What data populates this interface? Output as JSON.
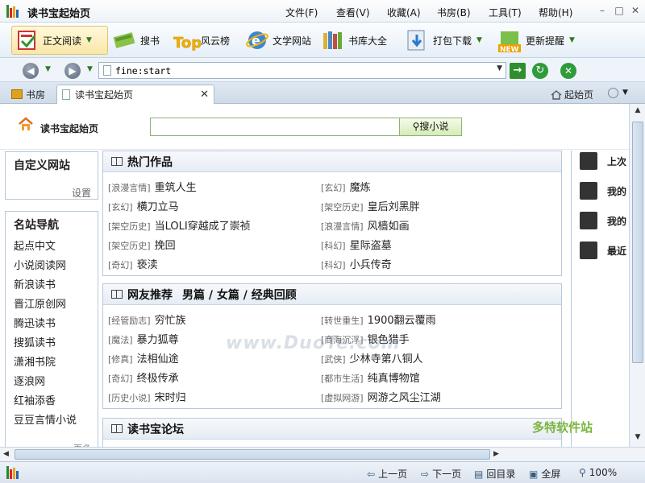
{
  "window": {
    "title": "读书宝起始页"
  },
  "menu": [
    "文件(F)",
    "查看(V)",
    "收藏(A)",
    "书房(B)",
    "工具(T)",
    "帮助(H)"
  ],
  "toolbar": [
    {
      "label": "正文阅读",
      "icon": "read-book-icon"
    },
    {
      "label": "搜书",
      "icon": "search-book-icon"
    },
    {
      "label": "风云榜",
      "icon": "top-ranking-icon"
    },
    {
      "label": "文学网站",
      "icon": "ie-globe-icon"
    },
    {
      "label": "书库大全",
      "icon": "library-icon"
    },
    {
      "label": "打包下载",
      "icon": "download-icon"
    },
    {
      "label": "更新提醒",
      "icon": "new-alert-icon"
    }
  ],
  "address": {
    "value": "fine:start"
  },
  "tabs": [
    {
      "label": "书房"
    },
    {
      "label": "读书宝起始页"
    }
  ],
  "tab_right": {
    "home_label": "起始页"
  },
  "page": {
    "title": "读书宝起始页",
    "search_button": "搜小说",
    "left": {
      "custom_title": "自定义网站",
      "settings": "设置",
      "nav_title": "名站导航",
      "nav_items": [
        "起点中文",
        "小说阅读网",
        "新浪读书",
        "晋江原创网",
        "腾迅读书",
        "搜狐读书",
        "潇湘书院",
        "逐浪网",
        "红袖添香",
        "豆豆言情小说"
      ],
      "more": "更多"
    },
    "hot": {
      "title": "热门作品",
      "items": [
        {
          "tag": "[浪漫言情]",
          "name": "重筑人生"
        },
        {
          "tag": "[玄幻]",
          "name": "魔炼"
        },
        {
          "tag": "[玄幻]",
          "name": "横刀立马"
        },
        {
          "tag": "[架空历史]",
          "name": "皇后刘黑胖"
        },
        {
          "tag": "[架空历史]",
          "name": "当LOLI穿越成了崇祯"
        },
        {
          "tag": "[浪漫言情]",
          "name": "风樯如画"
        },
        {
          "tag": "[架空历史]",
          "name": "挽回"
        },
        {
          "tag": "[科幻]",
          "name": "星际盗墓"
        },
        {
          "tag": "[奇幻]",
          "name": "亵渎"
        },
        {
          "tag": "[科幻]",
          "name": "小兵传奇"
        }
      ]
    },
    "rec": {
      "title": "网友推荐",
      "filters": "男篇 / 女篇 / 经典回顾",
      "items": [
        {
          "tag": "[经管励志]",
          "name": "穷忙族"
        },
        {
          "tag": "[转世重生]",
          "name": "1900翻云覆雨"
        },
        {
          "tag": "[魔法]",
          "name": "暴力狐尊"
        },
        {
          "tag": "[商海沉浮]",
          "name": "银色猎手"
        },
        {
          "tag": "[修真]",
          "name": "法相仙途"
        },
        {
          "tag": "[武侠]",
          "name": "少林寺第八铜人"
        },
        {
          "tag": "[奇幻]",
          "name": "终极传承"
        },
        {
          "tag": "[都市生活]",
          "name": "纯真博物馆"
        },
        {
          "tag": "[历史小说]",
          "name": "宋时归"
        },
        {
          "tag": "[虚拟网游]",
          "name": "网游之风尘江湖"
        }
      ]
    },
    "forum": {
      "title": "读书宝论坛"
    },
    "right": [
      "上次",
      "我的",
      "我的",
      "最近"
    ]
  },
  "status": {
    "prev": "上一页",
    "next": "下一页",
    "toc": "回目录",
    "full": "全屏",
    "zoom": "100%"
  },
  "watermark": "www.DuoTe.com",
  "watermark2": "多特软件站"
}
